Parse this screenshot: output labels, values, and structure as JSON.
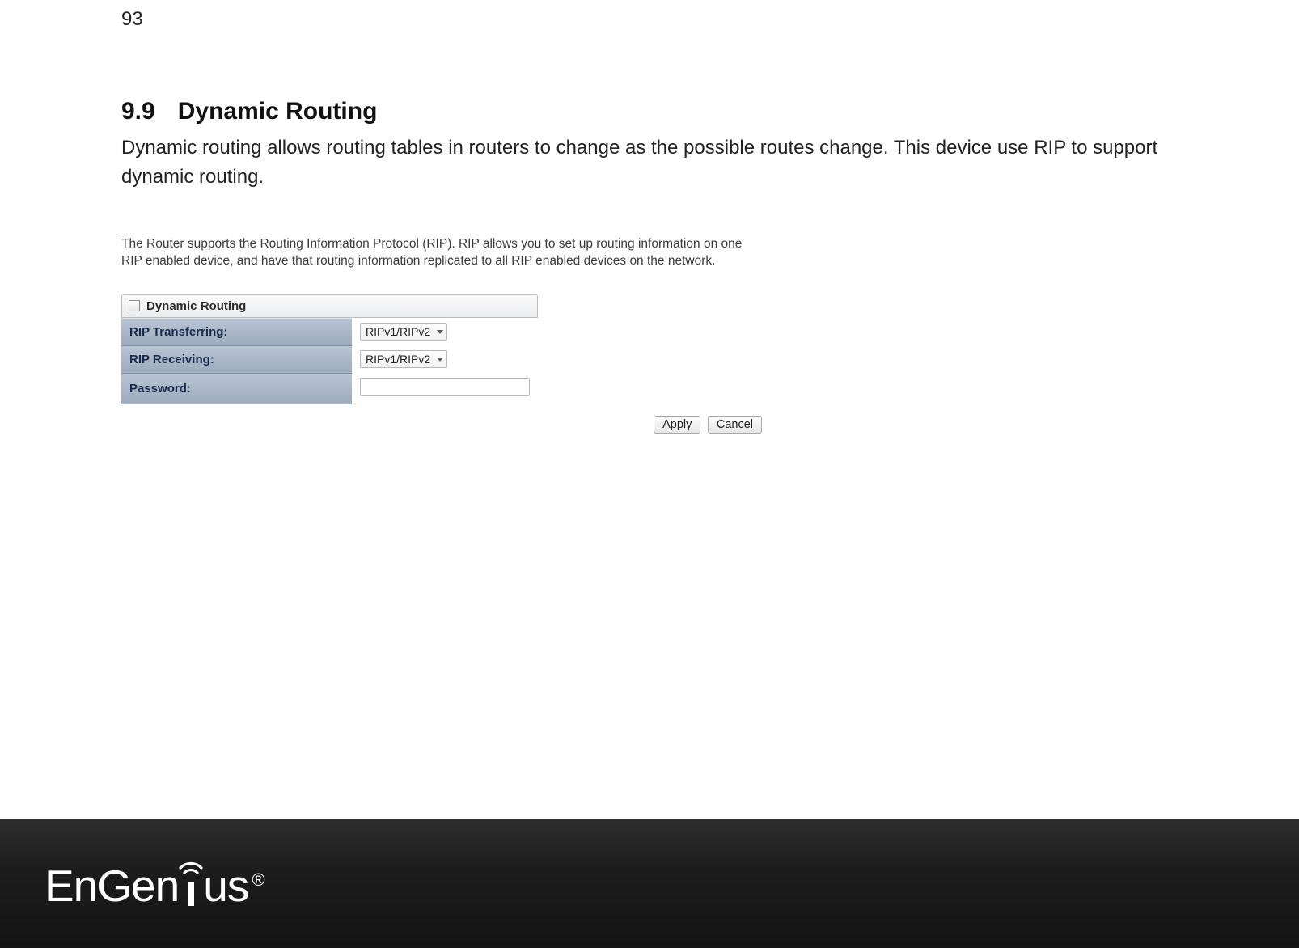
{
  "page_number": "93",
  "heading_number": "9.9",
  "heading_title": "Dynamic Routing",
  "body_paragraph": "Dynamic routing allows routing tables in routers to change as the possible routes change. This device use RIP to support dynamic routing.",
  "screenshot": {
    "description": "The Router supports the Routing Information Protocol (RIP). RIP allows you to set up routing information on one RIP enabled device, and have that routing information replicated to all RIP enabled devices on the network.",
    "panel_title": "Dynamic Routing",
    "rows": {
      "rip_transferring": {
        "label": "RIP Transferring:",
        "value": "RIPv1/RIPv2"
      },
      "rip_receiving": {
        "label": "RIP Receiving:",
        "value": "RIPv1/RIPv2"
      },
      "password": {
        "label": "Password:",
        "value": ""
      }
    },
    "buttons": {
      "apply": "Apply",
      "cancel": "Cancel"
    }
  },
  "brand": {
    "name_part1": "EnGen",
    "name_part2": "us",
    "registered": "®"
  }
}
